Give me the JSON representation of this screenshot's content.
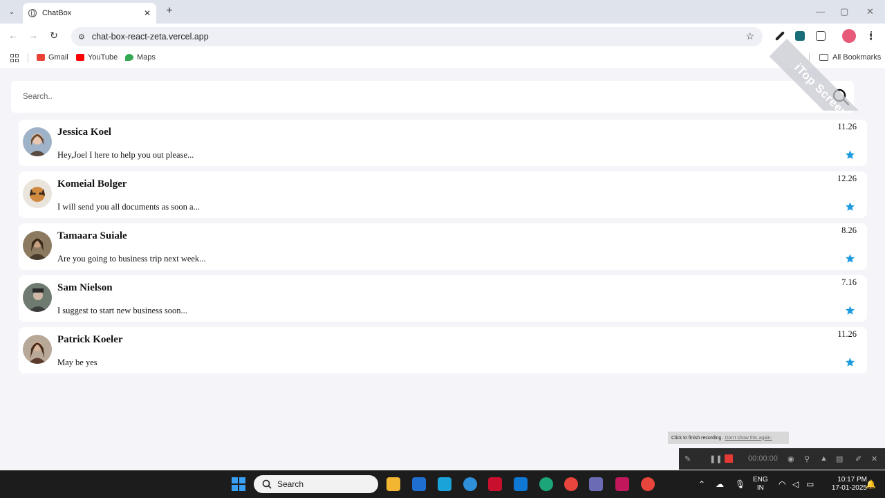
{
  "browser": {
    "tab_title": "ChatBox",
    "tab_close": "✕",
    "new_tab": "+",
    "tab_list": "⌄",
    "url": "chat-box-react-zeta.vercel.app",
    "back": "←",
    "forward": "→",
    "reload": "↻",
    "bookmark_star": "☆",
    "bookmarks": [
      {
        "label": "Gmail",
        "color": "#ea4335"
      },
      {
        "label": "YouTube",
        "color": "#ff0000"
      },
      {
        "label": "Maps",
        "color": "#34a853"
      }
    ],
    "all_bookmarks": "All Bookmarks"
  },
  "search": {
    "placeholder": "Search.."
  },
  "chats": [
    {
      "name": "Jessica Koel",
      "message": "Hey,Joel I here to help you out please...",
      "time": "11.26",
      "avatar_color": "#8a9bb0"
    },
    {
      "name": "Komeial Bolger",
      "message": "I will send you all documents as soon a...",
      "time": "12.26",
      "avatar_color": "#c98d4a"
    },
    {
      "name": "Tamaara Suiale",
      "message": "Are you going to business trip next week...",
      "time": "8.26",
      "avatar_color": "#8c7a60"
    },
    {
      "name": "Sam Nielson",
      "message": "I suggest to start new business soon...",
      "time": "7.16",
      "avatar_color": "#6f7a70"
    },
    {
      "name": "Patrick Koeler",
      "message": "May be yes",
      "time": "11.26",
      "avatar_color": "#7a5a4a"
    }
  ],
  "star_color": "#1e9be0",
  "recorder": {
    "tip_text": "Click to finish recording.",
    "tip_link": "Don't show this again.",
    "time": "00:00:00",
    "watermark": "iTop Screen Recorder"
  },
  "taskbar": {
    "search_label": "Search",
    "lang_1": "ENG",
    "lang_2": "IN",
    "clock_time": "10:17 PM",
    "clock_date": "17-01-2025"
  }
}
